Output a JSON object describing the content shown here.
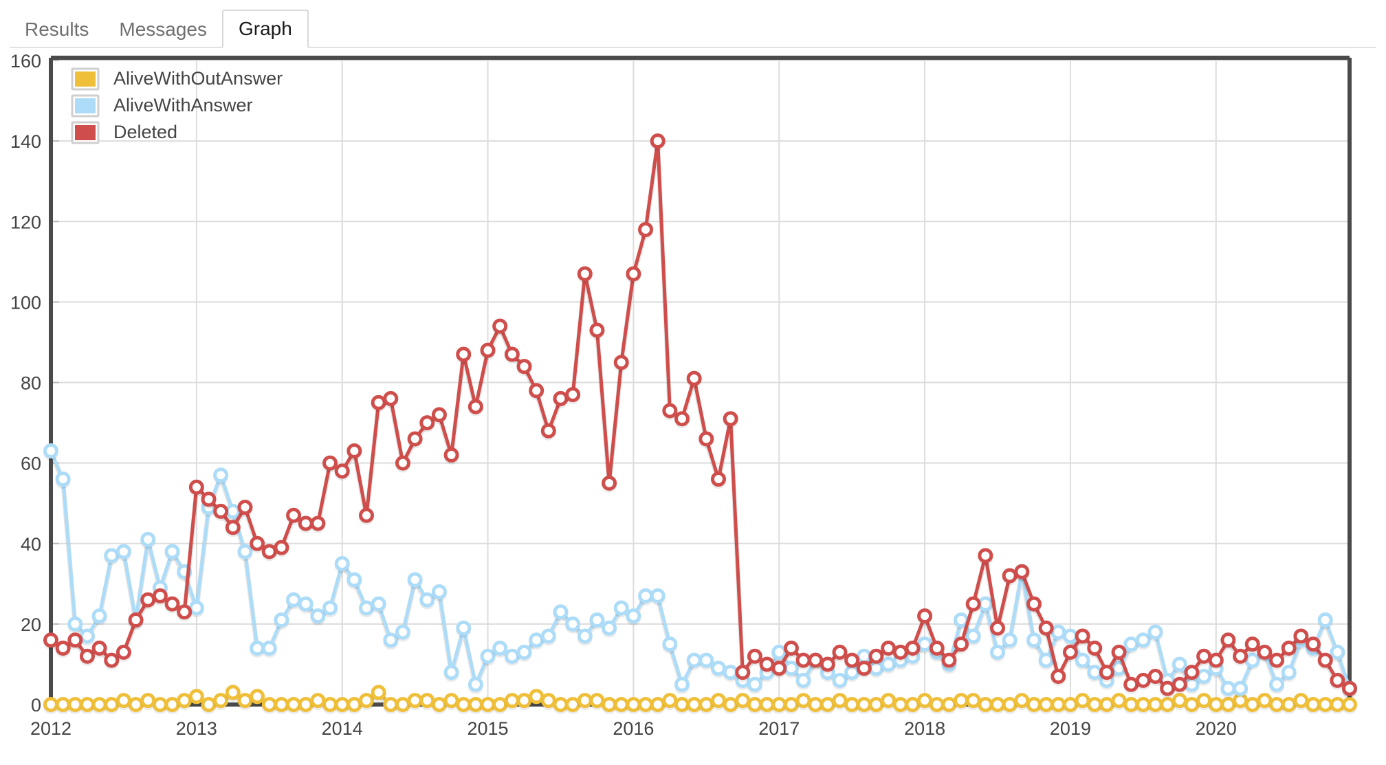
{
  "tabs": [
    {
      "id": "results",
      "label": "Results",
      "active": false
    },
    {
      "id": "messages",
      "label": "Messages",
      "active": false
    },
    {
      "id": "graph",
      "label": "Graph",
      "active": true
    }
  ],
  "chart_data": {
    "type": "line",
    "title": "",
    "subtitle": "",
    "xlabel": "",
    "ylabel": "",
    "ylim": [
      0,
      160
    ],
    "yticks": [
      0,
      20,
      40,
      60,
      80,
      100,
      120,
      140,
      160
    ],
    "xticks": [
      "2012",
      "2013",
      "2014",
      "2015",
      "2016",
      "2017",
      "2018",
      "2019",
      "2020"
    ],
    "grid": true,
    "legend_position": "top-left",
    "markers": "circle-open",
    "x_unit": "month",
    "x_start": "2012-01",
    "x": [
      "2012-01",
      "2012-02",
      "2012-03",
      "2012-04",
      "2012-05",
      "2012-06",
      "2012-07",
      "2012-08",
      "2012-09",
      "2012-10",
      "2012-11",
      "2012-12",
      "2013-01",
      "2013-02",
      "2013-03",
      "2013-04",
      "2013-05",
      "2013-06",
      "2013-07",
      "2013-08",
      "2013-09",
      "2013-10",
      "2013-11",
      "2013-12",
      "2014-01",
      "2014-02",
      "2014-03",
      "2014-04",
      "2014-05",
      "2014-06",
      "2014-07",
      "2014-08",
      "2014-09",
      "2014-10",
      "2014-11",
      "2014-12",
      "2015-01",
      "2015-02",
      "2015-03",
      "2015-04",
      "2015-05",
      "2015-06",
      "2015-07",
      "2015-08",
      "2015-09",
      "2015-10",
      "2015-11",
      "2015-12",
      "2016-01",
      "2016-02",
      "2016-03",
      "2016-04",
      "2016-05",
      "2016-06",
      "2016-07",
      "2016-08",
      "2016-09",
      "2016-10",
      "2016-11",
      "2016-12",
      "2017-01",
      "2017-02",
      "2017-03",
      "2017-04",
      "2017-05",
      "2017-06",
      "2017-07",
      "2017-08",
      "2017-09",
      "2017-10",
      "2017-11",
      "2017-12",
      "2018-01",
      "2018-02",
      "2018-03",
      "2018-04",
      "2018-05",
      "2018-06",
      "2018-07",
      "2018-08",
      "2018-09",
      "2018-10",
      "2018-11",
      "2018-12",
      "2019-01",
      "2019-02",
      "2019-03",
      "2019-04",
      "2019-05",
      "2019-06",
      "2019-07",
      "2019-08",
      "2019-09",
      "2019-10",
      "2019-11",
      "2019-12",
      "2020-01",
      "2020-02",
      "2020-03",
      "2020-04",
      "2020-05",
      "2020-06",
      "2020-07",
      "2020-08",
      "2020-09",
      "2020-10",
      "2020-11",
      "2020-12"
    ],
    "series": [
      {
        "name": "AliveWithOutAnswer",
        "color": "#efbf3a",
        "values": [
          0,
          0,
          0,
          0,
          0,
          0,
          1,
          0,
          1,
          0,
          0,
          1,
          2,
          0,
          1,
          3,
          1,
          2,
          0,
          0,
          0,
          0,
          1,
          0,
          0,
          0,
          1,
          3,
          0,
          0,
          1,
          1,
          0,
          1,
          0,
          0,
          0,
          0,
          1,
          1,
          2,
          1,
          0,
          0,
          1,
          1,
          0,
          0,
          0,
          0,
          0,
          1,
          0,
          0,
          0,
          1,
          0,
          1,
          0,
          0,
          0,
          0,
          1,
          0,
          0,
          1,
          0,
          0,
          0,
          1,
          0,
          0,
          1,
          0,
          0,
          1,
          1,
          0,
          0,
          0,
          1,
          0,
          0,
          0,
          0,
          1,
          0,
          0,
          1,
          0,
          0,
          0,
          0,
          1,
          0,
          1,
          0,
          0,
          1,
          0,
          1,
          0,
          0,
          1,
          0,
          0,
          0,
          0
        ]
      },
      {
        "name": "AliveWithAnswer",
        "color": "#addcf8",
        "values": [
          63,
          56,
          20,
          17,
          22,
          37,
          38,
          21,
          41,
          29,
          38,
          33,
          24,
          49,
          57,
          48,
          38,
          14,
          14,
          21,
          26,
          25,
          22,
          24,
          35,
          31,
          24,
          25,
          16,
          18,
          31,
          26,
          28,
          8,
          19,
          5,
          12,
          14,
          12,
          13,
          16,
          17,
          23,
          20,
          17,
          21,
          19,
          24,
          22,
          27,
          27,
          15,
          5,
          11,
          11,
          9,
          8,
          6,
          5,
          8,
          13,
          9,
          6,
          11,
          8,
          6,
          8,
          12,
          9,
          10,
          11,
          12,
          15,
          13,
          10,
          21,
          17,
          25,
          13,
          16,
          33,
          16,
          11,
          18,
          17,
          11,
          8,
          6,
          9,
          15,
          16,
          18,
          6,
          10,
          5,
          7,
          9,
          4,
          4,
          11,
          13,
          5,
          8,
          16,
          14,
          21,
          13,
          4
        ]
      },
      {
        "name": "Deleted",
        "color": "#cf4d4a",
        "values": [
          16,
          14,
          16,
          12,
          14,
          11,
          13,
          21,
          26,
          27,
          25,
          23,
          54,
          51,
          48,
          44,
          49,
          40,
          38,
          39,
          47,
          45,
          45,
          60,
          58,
          63,
          47,
          75,
          76,
          60,
          66,
          70,
          72,
          62,
          87,
          74,
          88,
          94,
          87,
          84,
          78,
          68,
          76,
          77,
          107,
          93,
          55,
          85,
          107,
          118,
          140,
          73,
          71,
          81,
          66,
          56,
          71,
          8,
          12,
          10,
          9,
          14,
          11,
          11,
          10,
          13,
          11,
          9,
          12,
          14,
          13,
          14,
          22,
          14,
          11,
          15,
          25,
          37,
          19,
          32,
          33,
          25,
          19,
          7,
          13,
          17,
          14,
          8,
          13,
          5,
          6,
          7,
          4,
          5,
          8,
          12,
          11,
          16,
          12,
          15,
          13,
          11,
          14,
          17,
          15,
          11,
          6,
          4
        ]
      }
    ]
  }
}
